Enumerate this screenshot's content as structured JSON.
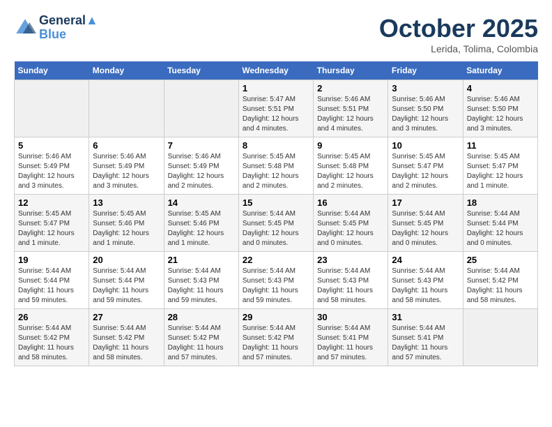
{
  "header": {
    "logo_line1": "General",
    "logo_line2": "Blue",
    "month": "October 2025",
    "location": "Lerida, Tolima, Colombia"
  },
  "weekdays": [
    "Sunday",
    "Monday",
    "Tuesday",
    "Wednesday",
    "Thursday",
    "Friday",
    "Saturday"
  ],
  "weeks": [
    [
      {
        "day": "",
        "info": ""
      },
      {
        "day": "",
        "info": ""
      },
      {
        "day": "",
        "info": ""
      },
      {
        "day": "1",
        "info": "Sunrise: 5:47 AM\nSunset: 5:51 PM\nDaylight: 12 hours\nand 4 minutes."
      },
      {
        "day": "2",
        "info": "Sunrise: 5:46 AM\nSunset: 5:51 PM\nDaylight: 12 hours\nand 4 minutes."
      },
      {
        "day": "3",
        "info": "Sunrise: 5:46 AM\nSunset: 5:50 PM\nDaylight: 12 hours\nand 3 minutes."
      },
      {
        "day": "4",
        "info": "Sunrise: 5:46 AM\nSunset: 5:50 PM\nDaylight: 12 hours\nand 3 minutes."
      }
    ],
    [
      {
        "day": "5",
        "info": "Sunrise: 5:46 AM\nSunset: 5:49 PM\nDaylight: 12 hours\nand 3 minutes."
      },
      {
        "day": "6",
        "info": "Sunrise: 5:46 AM\nSunset: 5:49 PM\nDaylight: 12 hours\nand 3 minutes."
      },
      {
        "day": "7",
        "info": "Sunrise: 5:46 AM\nSunset: 5:49 PM\nDaylight: 12 hours\nand 2 minutes."
      },
      {
        "day": "8",
        "info": "Sunrise: 5:45 AM\nSunset: 5:48 PM\nDaylight: 12 hours\nand 2 minutes."
      },
      {
        "day": "9",
        "info": "Sunrise: 5:45 AM\nSunset: 5:48 PM\nDaylight: 12 hours\nand 2 minutes."
      },
      {
        "day": "10",
        "info": "Sunrise: 5:45 AM\nSunset: 5:47 PM\nDaylight: 12 hours\nand 2 minutes."
      },
      {
        "day": "11",
        "info": "Sunrise: 5:45 AM\nSunset: 5:47 PM\nDaylight: 12 hours\nand 1 minute."
      }
    ],
    [
      {
        "day": "12",
        "info": "Sunrise: 5:45 AM\nSunset: 5:47 PM\nDaylight: 12 hours\nand 1 minute."
      },
      {
        "day": "13",
        "info": "Sunrise: 5:45 AM\nSunset: 5:46 PM\nDaylight: 12 hours\nand 1 minute."
      },
      {
        "day": "14",
        "info": "Sunrise: 5:45 AM\nSunset: 5:46 PM\nDaylight: 12 hours\nand 1 minute."
      },
      {
        "day": "15",
        "info": "Sunrise: 5:44 AM\nSunset: 5:45 PM\nDaylight: 12 hours\nand 0 minutes."
      },
      {
        "day": "16",
        "info": "Sunrise: 5:44 AM\nSunset: 5:45 PM\nDaylight: 12 hours\nand 0 minutes."
      },
      {
        "day": "17",
        "info": "Sunrise: 5:44 AM\nSunset: 5:45 PM\nDaylight: 12 hours\nand 0 minutes."
      },
      {
        "day": "18",
        "info": "Sunrise: 5:44 AM\nSunset: 5:44 PM\nDaylight: 12 hours\nand 0 minutes."
      }
    ],
    [
      {
        "day": "19",
        "info": "Sunrise: 5:44 AM\nSunset: 5:44 PM\nDaylight: 11 hours\nand 59 minutes."
      },
      {
        "day": "20",
        "info": "Sunrise: 5:44 AM\nSunset: 5:44 PM\nDaylight: 11 hours\nand 59 minutes."
      },
      {
        "day": "21",
        "info": "Sunrise: 5:44 AM\nSunset: 5:43 PM\nDaylight: 11 hours\nand 59 minutes."
      },
      {
        "day": "22",
        "info": "Sunrise: 5:44 AM\nSunset: 5:43 PM\nDaylight: 11 hours\nand 59 minutes."
      },
      {
        "day": "23",
        "info": "Sunrise: 5:44 AM\nSunset: 5:43 PM\nDaylight: 11 hours\nand 58 minutes."
      },
      {
        "day": "24",
        "info": "Sunrise: 5:44 AM\nSunset: 5:43 PM\nDaylight: 11 hours\nand 58 minutes."
      },
      {
        "day": "25",
        "info": "Sunrise: 5:44 AM\nSunset: 5:42 PM\nDaylight: 11 hours\nand 58 minutes."
      }
    ],
    [
      {
        "day": "26",
        "info": "Sunrise: 5:44 AM\nSunset: 5:42 PM\nDaylight: 11 hours\nand 58 minutes."
      },
      {
        "day": "27",
        "info": "Sunrise: 5:44 AM\nSunset: 5:42 PM\nDaylight: 11 hours\nand 58 minutes."
      },
      {
        "day": "28",
        "info": "Sunrise: 5:44 AM\nSunset: 5:42 PM\nDaylight: 11 hours\nand 57 minutes."
      },
      {
        "day": "29",
        "info": "Sunrise: 5:44 AM\nSunset: 5:42 PM\nDaylight: 11 hours\nand 57 minutes."
      },
      {
        "day": "30",
        "info": "Sunrise: 5:44 AM\nSunset: 5:41 PM\nDaylight: 11 hours\nand 57 minutes."
      },
      {
        "day": "31",
        "info": "Sunrise: 5:44 AM\nSunset: 5:41 PM\nDaylight: 11 hours\nand 57 minutes."
      },
      {
        "day": "",
        "info": ""
      }
    ]
  ]
}
